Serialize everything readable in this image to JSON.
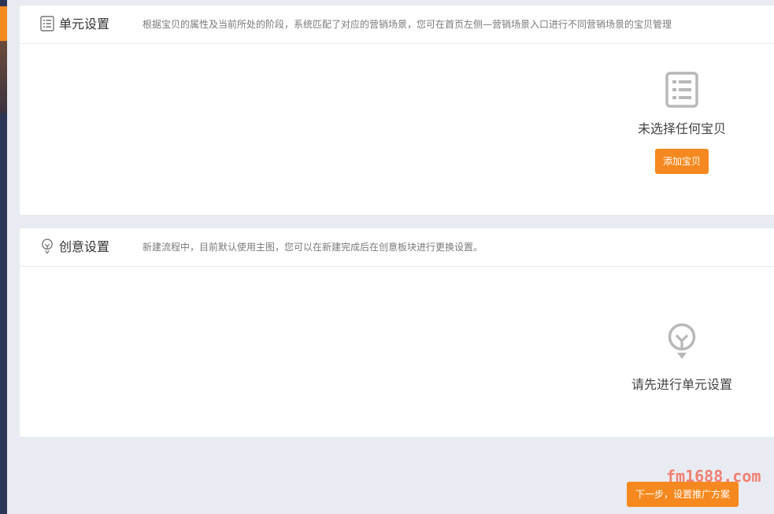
{
  "unit_panel": {
    "title": "单元设置",
    "description": "根据宝贝的属性及当前所处的阶段，系统匹配了对应的营销场景，您可在首页左侧—营销场景入口进行不同营销场景的宝贝管理",
    "empty_text": "未选择任何宝贝",
    "add_button_label": "添加宝贝",
    "header_icon": "list-icon",
    "empty_icon": "list-icon"
  },
  "creative_panel": {
    "title": "创意设置",
    "description": "新建流程中，目前默认使用主图，您可以在新建完成后在创意板块进行更换设置。",
    "empty_text": "请先进行单元设置",
    "header_icon": "lightbulb-icon",
    "empty_icon": "lightbulb-icon"
  },
  "footer": {
    "next_button_label": "下一步，设置推广方案",
    "watermark": "fm1688.com"
  },
  "colors": {
    "accent": "#f5891f",
    "background": "#e9ebf2",
    "sidebar": "#2c3555",
    "watermark": "#f08070"
  }
}
